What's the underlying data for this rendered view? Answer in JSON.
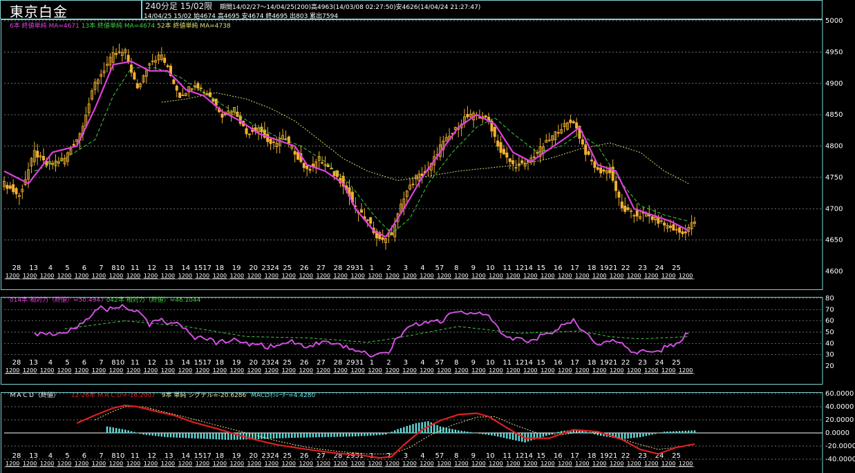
{
  "header": {
    "title": "東京白金",
    "bar_type": "240分足 15/02限",
    "period": "期間14/02/27～14/04/25(200)高4963(14/03/08 02:27:50)安4626(14/04/24 21:27:47)",
    "last_bar": "14/04/25 15/02 始4674 高4695 安4674 終4695 出803 累出7594"
  },
  "legends": {
    "ma6": "6本 終値単純 MA=4671",
    "ma13": "13本 終値単純 MA=4674",
    "ma52": "52本 終値単純 MA=4738",
    "rsi14": "014本 相対力（終値）=50.4947",
    "rsi42": "042本 相対力（終値）=46.1044",
    "macd_title": "ＭＡＣＤ（終値）",
    "macd_line": "12-26本 ＭＡＣＤ=-16.2007",
    "signal": "9本 単純 シグナル=-20.6286",
    "osc": "MACDｵｼﾚｰﾀｰ=4.4280"
  },
  "colors": {
    "candle": "#f0b030",
    "ma6": "#e040e0",
    "ma13": "#40d040",
    "ma52": "#d8e070",
    "rsi14": "#d050e0",
    "rsi42": "#40d040",
    "macd": "#e02020",
    "signal": "#e8e0a0",
    "osc": "#60e0e0",
    "grid": "#ffffff",
    "frame": "#7fd6d6"
  },
  "chart_data": [
    {
      "type": "candlestick",
      "bars": 200,
      "ylim": [
        4600,
        5000
      ],
      "yticks": [
        4600,
        4650,
        4700,
        4750,
        4800,
        4850,
        4900,
        4950,
        5000
      ],
      "date_labels": [
        "28",
        "13",
        "4",
        "5",
        "6",
        "7",
        "810",
        "11",
        "12",
        "13",
        "14",
        "1517",
        "18",
        "19",
        "20",
        "2324",
        "25",
        "26",
        "27",
        "28",
        "2931",
        "1",
        "2",
        "3",
        "4",
        "57",
        "8",
        "9",
        "10",
        "11",
        "1214",
        "15",
        "16",
        "17",
        "18",
        "1921",
        "22",
        "23",
        "24",
        "25"
      ],
      "time_label": "1200",
      "close_path": [
        [
          0,
          4740
        ],
        [
          5,
          4720
        ],
        [
          10,
          4790
        ],
        [
          14,
          4770
        ],
        [
          20,
          4780
        ],
        [
          25,
          4820
        ],
        [
          30,
          4900
        ],
        [
          36,
          4945
        ],
        [
          40,
          4950
        ],
        [
          44,
          4890
        ],
        [
          48,
          4935
        ],
        [
          52,
          4945
        ],
        [
          58,
          4880
        ],
        [
          63,
          4900
        ],
        [
          68,
          4880
        ],
        [
          72,
          4850
        ],
        [
          76,
          4860
        ],
        [
          80,
          4820
        ],
        [
          84,
          4830
        ],
        [
          88,
          4800
        ],
        [
          92,
          4815
        ],
        [
          96,
          4790
        ],
        [
          100,
          4760
        ],
        [
          104,
          4780
        ],
        [
          108,
          4760
        ],
        [
          112,
          4740
        ],
        [
          116,
          4700
        ],
        [
          120,
          4680
        ],
        [
          124,
          4650
        ],
        [
          128,
          4660
        ],
        [
          132,
          4720
        ],
        [
          136,
          4750
        ],
        [
          140,
          4760
        ],
        [
          144,
          4800
        ],
        [
          148,
          4820
        ],
        [
          152,
          4845
        ],
        [
          156,
          4850
        ],
        [
          160,
          4840
        ],
        [
          164,
          4790
        ],
        [
          168,
          4770
        ],
        [
          172,
          4770
        ],
        [
          176,
          4790
        ],
        [
          180,
          4810
        ],
        [
          184,
          4830
        ],
        [
          188,
          4840
        ],
        [
          192,
          4790
        ],
        [
          196,
          4760
        ],
        [
          200,
          4760
        ],
        [
          204,
          4700
        ],
        [
          208,
          4690
        ],
        [
          212,
          4690
        ],
        [
          216,
          4680
        ],
        [
          220,
          4670
        ],
        [
          224,
          4660
        ],
        [
          228,
          4680
        ]
      ],
      "ma6_path": [
        [
          0,
          4760
        ],
        [
          8,
          4740
        ],
        [
          16,
          4790
        ],
        [
          24,
          4800
        ],
        [
          30,
          4860
        ],
        [
          36,
          4930
        ],
        [
          42,
          4935
        ],
        [
          48,
          4920
        ],
        [
          54,
          4920
        ],
        [
          60,
          4890
        ],
        [
          66,
          4880
        ],
        [
          72,
          4855
        ],
        [
          78,
          4840
        ],
        [
          84,
          4820
        ],
        [
          90,
          4810
        ],
        [
          96,
          4800
        ],
        [
          100,
          4770
        ],
        [
          106,
          4760
        ],
        [
          112,
          4740
        ],
        [
          116,
          4700
        ],
        [
          122,
          4665
        ],
        [
          126,
          4655
        ],
        [
          132,
          4700
        ],
        [
          138,
          4750
        ],
        [
          144,
          4790
        ],
        [
          150,
          4830
        ],
        [
          156,
          4850
        ],
        [
          162,
          4835
        ],
        [
          168,
          4790
        ],
        [
          174,
          4775
        ],
        [
          180,
          4795
        ],
        [
          186,
          4815
        ],
        [
          190,
          4830
        ],
        [
          196,
          4770
        ],
        [
          202,
          4760
        ],
        [
          208,
          4700
        ],
        [
          214,
          4690
        ],
        [
          220,
          4680
        ],
        [
          226,
          4665
        ]
      ],
      "ma13_path": [
        [
          10,
          4760
        ],
        [
          20,
          4780
        ],
        [
          30,
          4810
        ],
        [
          36,
          4880
        ],
        [
          42,
          4925
        ],
        [
          50,
          4925
        ],
        [
          58,
          4910
        ],
        [
          66,
          4885
        ],
        [
          74,
          4860
        ],
        [
          82,
          4835
        ],
        [
          90,
          4815
        ],
        [
          98,
          4800
        ],
        [
          106,
          4775
        ],
        [
          114,
          4740
        ],
        [
          122,
          4690
        ],
        [
          128,
          4660
        ],
        [
          134,
          4685
        ],
        [
          140,
          4740
        ],
        [
          148,
          4790
        ],
        [
          156,
          4830
        ],
        [
          162,
          4845
        ],
        [
          168,
          4820
        ],
        [
          176,
          4790
        ],
        [
          184,
          4800
        ],
        [
          190,
          4820
        ],
        [
          196,
          4800
        ],
        [
          204,
          4740
        ],
        [
          210,
          4705
        ],
        [
          218,
          4690
        ],
        [
          226,
          4680
        ]
      ],
      "ma52_path": [
        [
          52,
          4870
        ],
        [
          60,
          4875
        ],
        [
          70,
          4885
        ],
        [
          80,
          4875
        ],
        [
          88,
          4860
        ],
        [
          96,
          4840
        ],
        [
          104,
          4810
        ],
        [
          112,
          4780
        ],
        [
          120,
          4760
        ],
        [
          130,
          4745
        ],
        [
          140,
          4752
        ],
        [
          150,
          4760
        ],
        [
          160,
          4765
        ],
        [
          170,
          4770
        ],
        [
          180,
          4780
        ],
        [
          190,
          4795
        ],
        [
          200,
          4805
        ],
        [
          210,
          4790
        ],
        [
          218,
          4760
        ],
        [
          226,
          4740
        ]
      ]
    },
    {
      "type": "line",
      "title": "相対力",
      "ylim": [
        20,
        80
      ],
      "yticks": [
        20,
        30,
        40,
        50,
        60,
        70,
        80
      ],
      "series": [
        {
          "name": "014本 相対力（終値）",
          "points": [
            [
              10,
              47
            ],
            [
              14,
              48
            ],
            [
              20,
              51
            ],
            [
              24,
              55
            ],
            [
              28,
              64
            ],
            [
              32,
              71
            ],
            [
              36,
              70
            ],
            [
              40,
              73
            ],
            [
              44,
              68
            ],
            [
              48,
              57
            ],
            [
              52,
              60
            ],
            [
              58,
              57
            ],
            [
              62,
              45
            ],
            [
              66,
              46
            ],
            [
              70,
              40
            ],
            [
              76,
              43
            ],
            [
              82,
              39
            ],
            [
              88,
              37
            ],
            [
              94,
              42
            ],
            [
              100,
              38
            ],
            [
              106,
              40
            ],
            [
              112,
              37
            ],
            [
              118,
              33
            ],
            [
              122,
              29
            ],
            [
              126,
              30
            ],
            [
              130,
              45
            ],
            [
              134,
              55
            ],
            [
              138,
              58
            ],
            [
              144,
              60
            ],
            [
              148,
              66
            ],
            [
              152,
              68
            ],
            [
              156,
              67
            ],
            [
              160,
              64
            ],
            [
              164,
              49
            ],
            [
              168,
              44
            ],
            [
              172,
              42
            ],
            [
              178,
              47
            ],
            [
              184,
              55
            ],
            [
              188,
              60
            ],
            [
              192,
              50
            ],
            [
              196,
              38
            ],
            [
              202,
              42
            ],
            [
              208,
              33
            ],
            [
              214,
              31
            ],
            [
              218,
              36
            ],
            [
              222,
              40
            ],
            [
              226,
              50
            ]
          ]
        },
        {
          "name": "042本 相対力（終値）",
          "points": [
            [
              20,
              53
            ],
            [
              40,
              60
            ],
            [
              60,
              55
            ],
            [
              80,
              46
            ],
            [
              100,
              45
            ],
            [
              120,
              41
            ],
            [
              130,
              45
            ],
            [
              150,
              55
            ],
            [
              160,
              52
            ],
            [
              170,
              49
            ],
            [
              180,
              50
            ],
            [
              190,
              51
            ],
            [
              200,
              46
            ],
            [
              210,
              44
            ],
            [
              226,
              46
            ]
          ]
        }
      ]
    },
    {
      "type": "line",
      "title": "ＭＡＣＤ（終値）",
      "ylim": [
        -40,
        60
      ],
      "yticks": [
        -40,
        -20,
        0,
        20,
        40,
        60
      ],
      "series": [
        {
          "name": "12-26本 ＭＡＣＤ",
          "points": [
            [
              24,
              15
            ],
            [
              30,
              27
            ],
            [
              36,
              38
            ],
            [
              40,
              42
            ],
            [
              44,
              40
            ],
            [
              50,
              33
            ],
            [
              56,
              27
            ],
            [
              62,
              17
            ],
            [
              70,
              7
            ],
            [
              80,
              -7
            ],
            [
              90,
              -18
            ],
            [
              100,
              -25
            ],
            [
              110,
              -31
            ],
            [
              118,
              -34
            ],
            [
              124,
              -38
            ],
            [
              128,
              -36
            ],
            [
              132,
              -18
            ],
            [
              138,
              5
            ],
            [
              144,
              19
            ],
            [
              150,
              28
            ],
            [
              156,
              30
            ],
            [
              160,
              25
            ],
            [
              166,
              8
            ],
            [
              172,
              -8
            ],
            [
              180,
              -8
            ],
            [
              188,
              5
            ],
            [
              196,
              2
            ],
            [
              204,
              -10
            ],
            [
              210,
              -25
            ],
            [
              216,
              -32
            ],
            [
              222,
              -22
            ],
            [
              228,
              -17
            ]
          ]
        },
        {
          "name": "9本 単純 シグナル",
          "points": [
            [
              30,
              20
            ],
            [
              36,
              33
            ],
            [
              40,
              40
            ],
            [
              46,
              40
            ],
            [
              52,
              33
            ],
            [
              60,
              24
            ],
            [
              70,
              12
            ],
            [
              80,
              0
            ],
            [
              90,
              -12
            ],
            [
              100,
              -22
            ],
            [
              110,
              -28
            ],
            [
              120,
              -32
            ],
            [
              128,
              -32
            ],
            [
              134,
              -22
            ],
            [
              140,
              -5
            ],
            [
              148,
              12
            ],
            [
              156,
              24
            ],
            [
              162,
              25
            ],
            [
              168,
              13
            ],
            [
              176,
              0
            ],
            [
              184,
              -3
            ],
            [
              192,
              3
            ],
            [
              200,
              -3
            ],
            [
              208,
              -15
            ],
            [
              216,
              -25
            ],
            [
              224,
              -21
            ]
          ]
        },
        {
          "name": "MACDｵｼﾚｰﾀｰ",
          "points": [
            [
              34,
              10
            ],
            [
              40,
              5
            ],
            [
              46,
              -2
            ],
            [
              54,
              -6
            ],
            [
              64,
              -8
            ],
            [
              74,
              -10
            ],
            [
              84,
              -9
            ],
            [
              94,
              -7
            ],
            [
              104,
              -6
            ],
            [
              114,
              -5
            ],
            [
              120,
              -4
            ],
            [
              126,
              -2
            ],
            [
              130,
              6
            ],
            [
              136,
              15
            ],
            [
              140,
              18
            ],
            [
              144,
              10
            ],
            [
              150,
              4
            ],
            [
              156,
              0
            ],
            [
              162,
              -4
            ],
            [
              168,
              -10
            ],
            [
              172,
              -14
            ],
            [
              176,
              -8
            ],
            [
              184,
              3
            ],
            [
              190,
              5
            ],
            [
              196,
              -3
            ],
            [
              204,
              -9
            ],
            [
              210,
              -6
            ],
            [
              218,
              2
            ],
            [
              228,
              4
            ]
          ]
        }
      ]
    }
  ]
}
